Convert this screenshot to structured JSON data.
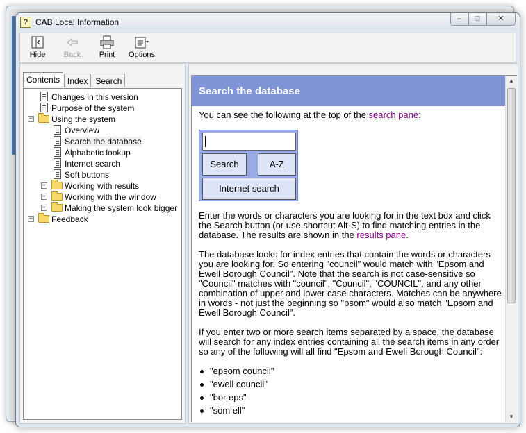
{
  "window": {
    "title": "CAB Local Information",
    "controls": {
      "minimize": "‒",
      "maximize": "□",
      "close": "✕"
    }
  },
  "toolbar": {
    "hide": "Hide",
    "back": "Back",
    "print": "Print",
    "options": "Options"
  },
  "tabs": {
    "contents": "Contents",
    "index": "Index",
    "search": "Search"
  },
  "tree": {
    "changes": "Changes in this version",
    "purpose": "Purpose of the system",
    "using": "Using the system",
    "overview": "Overview",
    "search_db": "Search the database",
    "alpha": "Alphabetic lookup",
    "internet": "Internet search",
    "soft": "Soft buttons",
    "working_results": "Working with results",
    "working_window": "Working with the window",
    "making_bigger": "Making the system look bigger",
    "feedback": "Feedback",
    "collapse_symbol": "−",
    "expand_symbol": "+"
  },
  "content": {
    "heading": "Search the database",
    "intro_before": "You can see the following at the top of the ",
    "intro_link": "search pane",
    "intro_after": ":",
    "widget": {
      "search": "Search",
      "az": "A-Z",
      "internet": "Internet search"
    },
    "p1_before": "Enter the words or characters you are looking for in the text box and click the Search button (or use shortcut Alt-S) to find matching entries in the database. The results are shown in the ",
    "p1_link": "results pane",
    "p1_after": ".",
    "p2": "The database looks for index entries that contain the words or characters you are looking for. So entering \"council\" would match with \"Epsom and Ewell Borough Council\". Note that the search is not case-sensitive so \"Council\" matches with \"council\", \"Council\", \"COUNCIL\", and any other combination of upper and lower case characters. Matches can be anywhere in words - not just the beginning so \"psom\" would also match \"Epsom and Ewell Borough Council\".",
    "p3": "If you enter two or more search items separated by a space, the database will search for any index entries containing all the search items in any order so any of the following will all find \"Epsom and Ewell Borough Council\":",
    "bullets": [
      "\"epsom council\"",
      "\"ewell council\"",
      "\"bor eps\"",
      "\"som ell\""
    ]
  },
  "colors": {
    "header_bg": "#7f94d4",
    "link": "#800080",
    "widget_bg": "#9aaae6"
  }
}
